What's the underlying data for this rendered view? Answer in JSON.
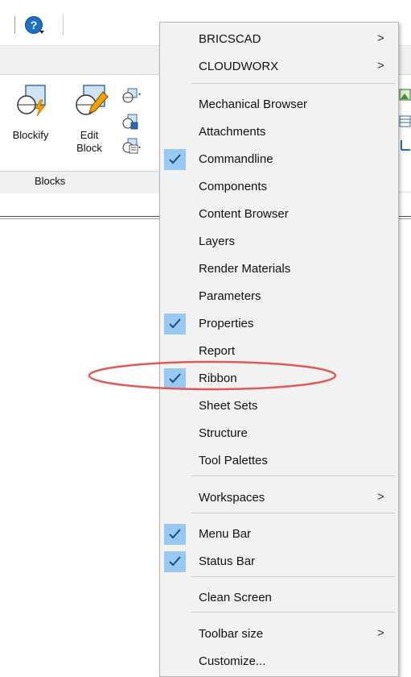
{
  "toolbar": {
    "help_icon": "help-question-icon",
    "help_glyph": "?"
  },
  "ribbon": {
    "blockify_label": "Blockify",
    "editblock_label_line1": "Edit",
    "editblock_label_line2": "Block",
    "panel_title": "Blocks"
  },
  "menu": {
    "items": [
      {
        "label": "BRICSCAD",
        "submenu": true,
        "checked": false
      },
      {
        "label": "CLOUDWORX",
        "submenu": true,
        "checked": false
      },
      {
        "label": "Mechanical Browser",
        "submenu": false,
        "checked": false
      },
      {
        "label": "Attachments",
        "submenu": false,
        "checked": false
      },
      {
        "label": "Commandline",
        "submenu": false,
        "checked": true
      },
      {
        "label": "Components",
        "submenu": false,
        "checked": false
      },
      {
        "label": "Content Browser",
        "submenu": false,
        "checked": false
      },
      {
        "label": "Layers",
        "submenu": false,
        "checked": false
      },
      {
        "label": "Render Materials",
        "submenu": false,
        "checked": false
      },
      {
        "label": "Parameters",
        "submenu": false,
        "checked": false
      },
      {
        "label": "Properties",
        "submenu": false,
        "checked": true
      },
      {
        "label": "Report",
        "submenu": false,
        "checked": false
      },
      {
        "label": "Ribbon",
        "submenu": false,
        "checked": true
      },
      {
        "label": "Sheet Sets",
        "submenu": false,
        "checked": false
      },
      {
        "label": "Structure",
        "submenu": false,
        "checked": false
      },
      {
        "label": "Tool Palettes",
        "submenu": false,
        "checked": false
      },
      {
        "label": "Workspaces",
        "submenu": true,
        "checked": false
      },
      {
        "label": "Menu Bar",
        "submenu": false,
        "checked": true
      },
      {
        "label": "Status Bar",
        "submenu": false,
        "checked": true
      },
      {
        "label": "Clean Screen",
        "submenu": false,
        "checked": false
      },
      {
        "label": "Toolbar size",
        "submenu": true,
        "checked": false
      },
      {
        "label": "Customize...",
        "submenu": false,
        "checked": false
      }
    ],
    "submenu_arrow": ">",
    "check_color": "#99c9f0"
  },
  "annotation": {
    "highlighted_item": "Ribbon",
    "ellipse_color": "#e05a5a"
  }
}
